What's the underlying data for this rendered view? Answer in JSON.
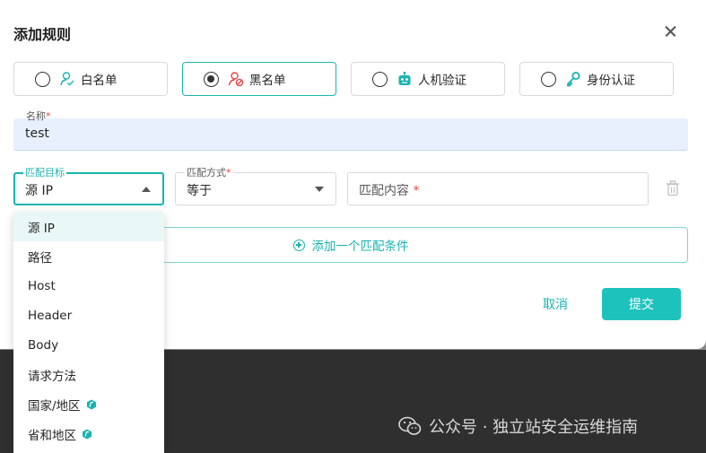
{
  "dialog": {
    "title": "添加规则"
  },
  "rule_types": [
    {
      "label": "白名单",
      "selected": false
    },
    {
      "label": "黑名单",
      "selected": true
    },
    {
      "label": "人机验证",
      "selected": false
    },
    {
      "label": "身份认证",
      "selected": false
    }
  ],
  "name_field": {
    "label": "名称",
    "required_mark": "*",
    "value": "test"
  },
  "match_target": {
    "label": "匹配目标",
    "value": "源 IP"
  },
  "match_method": {
    "label": "匹配方式",
    "required_mark": "*",
    "value": "等于"
  },
  "match_content": {
    "placeholder": "匹配内容",
    "required_mark": "*"
  },
  "add_condition_label": "添加一个匹配条件",
  "buttons": {
    "cancel": "取消",
    "submit": "提交"
  },
  "dropdown_options": [
    {
      "label": "源 IP",
      "pro": false
    },
    {
      "label": "路径",
      "pro": false
    },
    {
      "label": "Host",
      "pro": false
    },
    {
      "label": "Header",
      "pro": false
    },
    {
      "label": "Body",
      "pro": false
    },
    {
      "label": "请求方法",
      "pro": false
    },
    {
      "label": "国家/地区",
      "pro": true
    },
    {
      "label": "省和地区",
      "pro": true
    }
  ],
  "watermark": "公众号 · 独立站安全运维指南",
  "colors": {
    "accent": "#19b4b0",
    "required": "#e84749",
    "input_fill": "#e8f0fe"
  }
}
